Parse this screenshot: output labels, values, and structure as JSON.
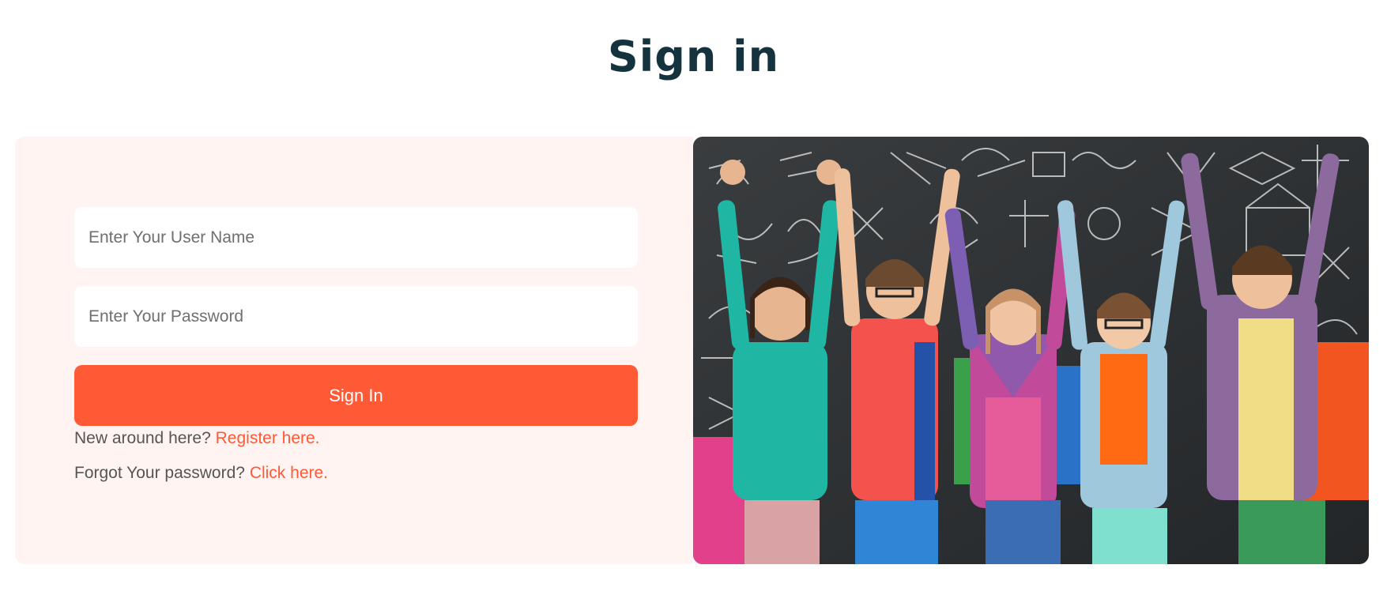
{
  "header": {
    "title": "Sign in"
  },
  "form": {
    "username_placeholder": "Enter Your User Name",
    "username_value": "",
    "password_placeholder": "Enter Your Password",
    "password_value": "",
    "submit_label": "Sign In",
    "register_prompt": "New around here?",
    "register_link": "Register here.",
    "forgot_prompt": "Forgot Your password?",
    "forgot_link": "Click here."
  },
  "colors": {
    "accent": "#ff5a36",
    "title": "#14333f",
    "panel_bg": "#fff4f2"
  },
  "hero_image": {
    "icon": "group-of-kids-photo"
  }
}
